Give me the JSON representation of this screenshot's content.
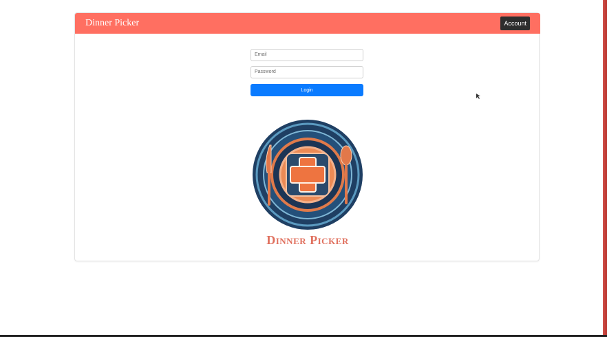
{
  "navbar": {
    "brand": "Dinner Picker",
    "account_label": "Account"
  },
  "login_form": {
    "email_placeholder": "Email",
    "password_placeholder": "Password",
    "login_label": "Login"
  },
  "logo": {
    "text": "Dinner Picker"
  },
  "colors": {
    "navbar": "#ff6f61",
    "login_button": "#0a7bff",
    "account_button": "#2d2d2d",
    "logo_text": "#e0705e"
  }
}
